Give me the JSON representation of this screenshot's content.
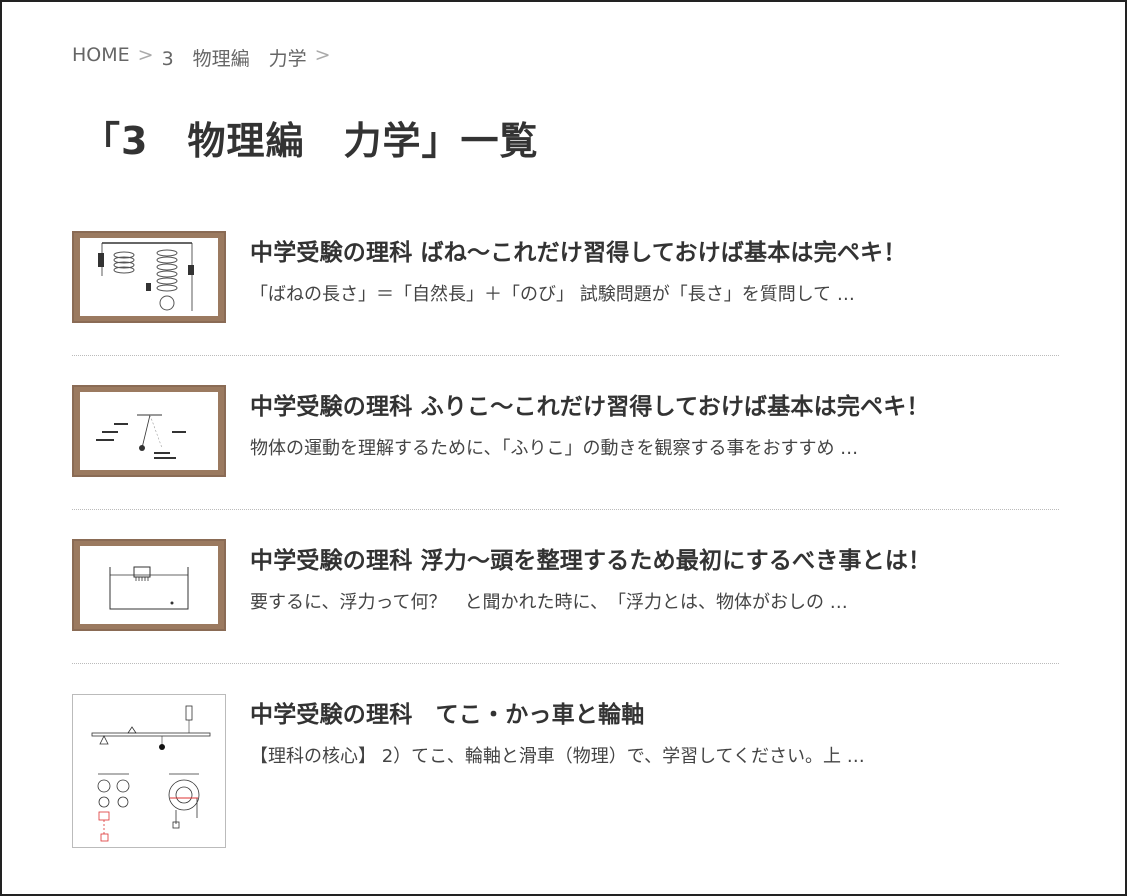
{
  "breadcrumb": {
    "home": "HOME",
    "separator": ">",
    "category": "3　物理編　力学"
  },
  "page_title": "「3　物理編　力学」一覧",
  "posts": [
    {
      "title": "中学受験の理科 ばね〜これだけ習得しておけば基本は完ペキ！",
      "excerpt": "「ばねの長さ」＝「自然長」＋「のび」 試験問題が「長さ」を質問して …"
    },
    {
      "title": "中学受験の理科 ふりこ〜これだけ習得しておけば基本は完ペキ！",
      "excerpt": "物体の運動を理解するために、「ふりこ」の動きを観察する事をおすすめ …"
    },
    {
      "title": "中学受験の理科 浮力〜頭を整理するため最初にするべき事とは！",
      "excerpt": "要するに、浮力って何？　と聞かれた時に、　「浮力とは、物体がおしの …"
    },
    {
      "title": "中学受験の理科　てこ・かっ車と輪軸",
      "excerpt": "【理科の核心】 2）てこ、輪軸と滑車（物理）で、学習してください。上 …"
    }
  ],
  "colors": {
    "wood_frame": "#8a6b55",
    "text": "#333333",
    "breadcrumb": "#666666"
  }
}
